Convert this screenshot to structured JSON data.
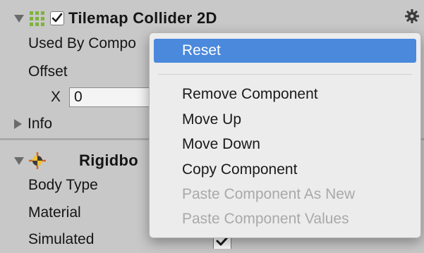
{
  "component": {
    "title": "Tilemap Collider 2D",
    "enabled": true,
    "fields": {
      "used_by_composite_label": "Used By Compo",
      "offset_label": "Offset",
      "x_label": "X",
      "x_value": "0",
      "info_label": "Info"
    }
  },
  "rigidbody": {
    "title": "Rigidbo",
    "fields": {
      "body_type_label": "Body Type",
      "material_label": "Material",
      "simulated_label": "Simulated"
    },
    "simulated_checked": true
  },
  "context_menu": {
    "items": [
      {
        "label": "Reset",
        "enabled": true,
        "highlighted": true
      },
      {
        "label": "Remove Component",
        "enabled": true,
        "highlighted": false
      },
      {
        "label": "Move Up",
        "enabled": true,
        "highlighted": false
      },
      {
        "label": "Move Down",
        "enabled": true,
        "highlighted": false
      },
      {
        "label": "Copy Component",
        "enabled": true,
        "highlighted": false
      },
      {
        "label": "Paste Component As New",
        "enabled": false,
        "highlighted": false
      },
      {
        "label": "Paste Component Values",
        "enabled": false,
        "highlighted": false
      }
    ]
  },
  "icons": {
    "foldout_expanded": "triangle-down-icon",
    "foldout_collapsed": "triangle-right-icon",
    "tilemap_collider": "grid-icon",
    "rigidbody": "rigidbody-icon",
    "settings": "gear-icon",
    "checkbox": "checkmark-icon"
  },
  "colors": {
    "panel_bg": "#c8c8c8",
    "menu_bg": "#ececec",
    "highlight": "#4a89dc",
    "disabled_text": "#a9a9a9",
    "grid_icon": "#7fb33a"
  }
}
